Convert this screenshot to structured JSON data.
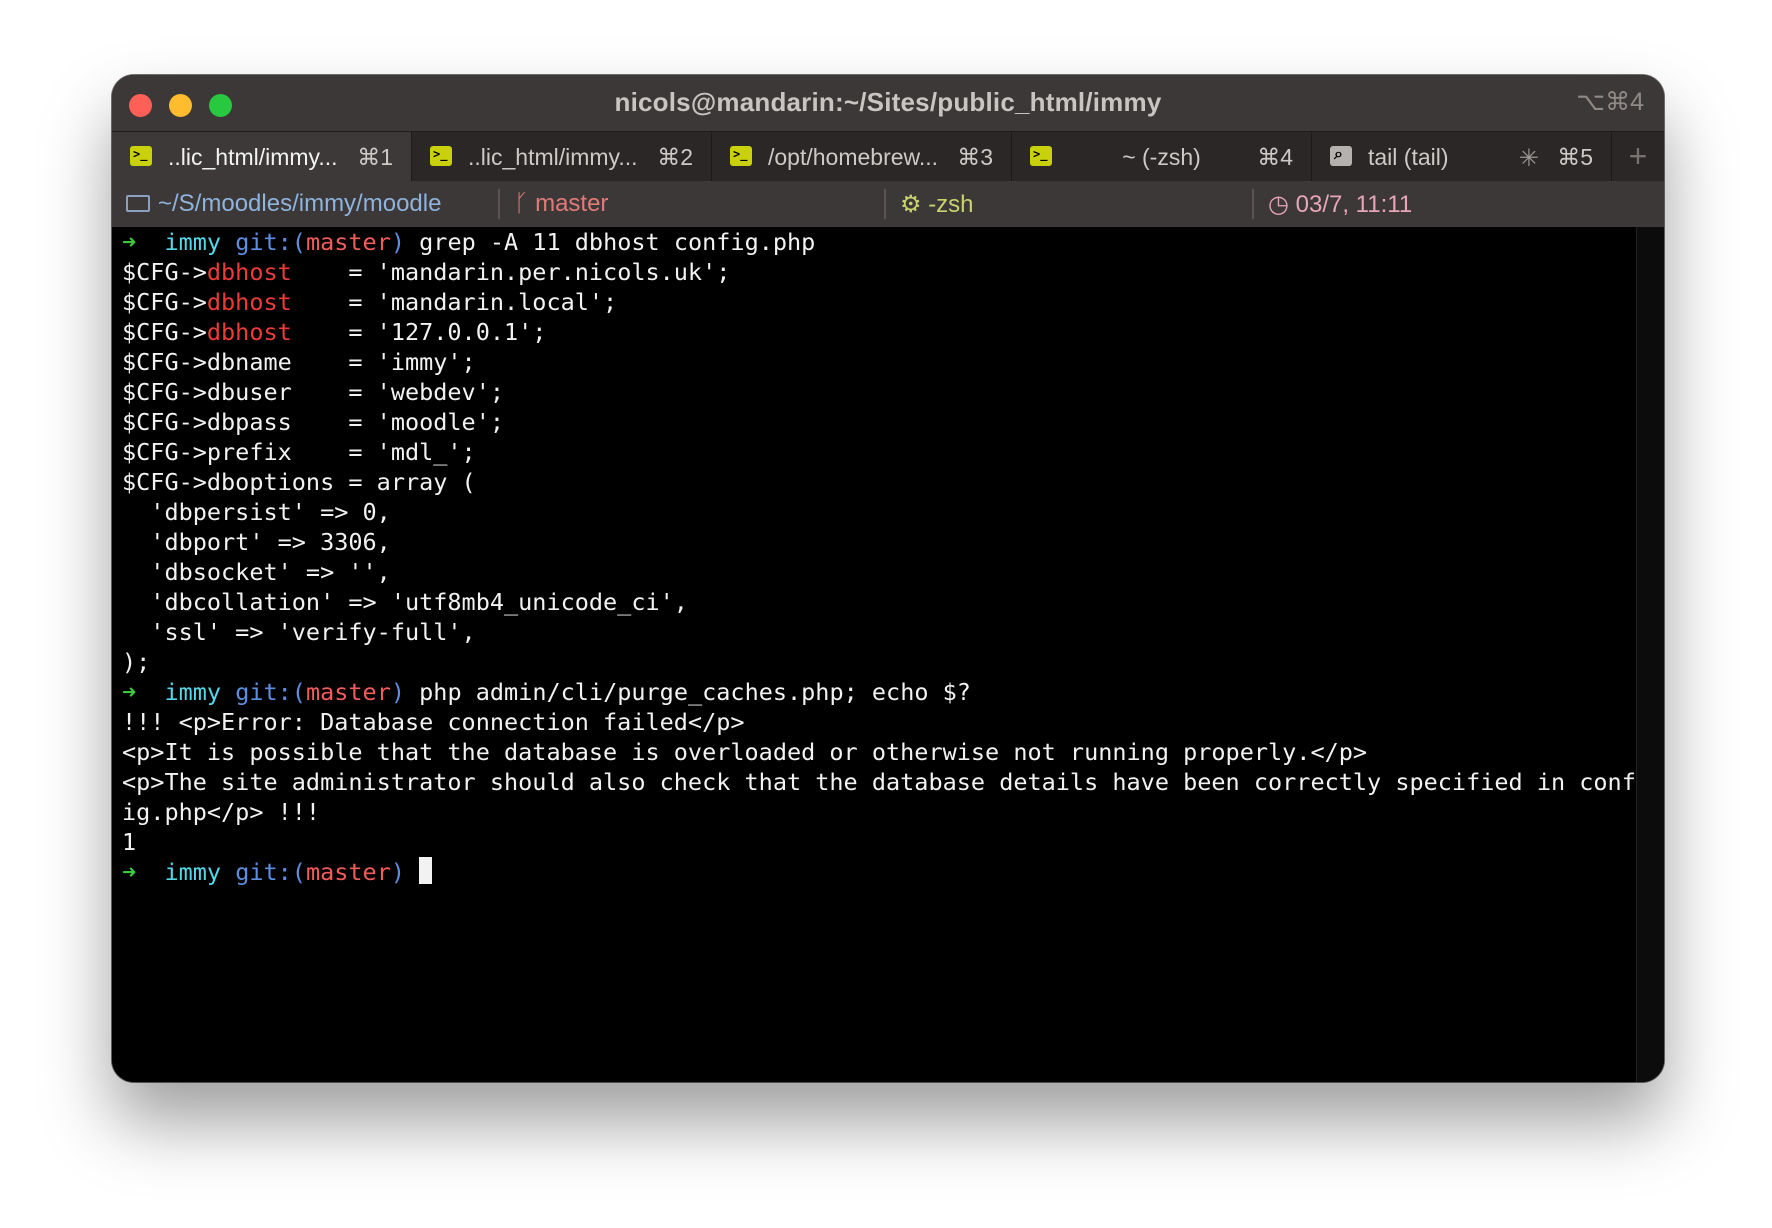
{
  "window": {
    "title": "nicols@mandarin:~/Sites/public_html/immy",
    "shortcut": "⌥⌘4"
  },
  "tabs": [
    {
      "label": "..lic_html/immy...",
      "shortcut": "⌘1",
      "icon": "terminal-icon",
      "active": true
    },
    {
      "label": "..lic_html/immy...",
      "shortcut": "⌘2",
      "icon": "terminal-icon",
      "active": false
    },
    {
      "label": "/opt/homebrew...",
      "shortcut": "⌘3",
      "icon": "terminal-icon",
      "active": false
    },
    {
      "label": "~ (-zsh)",
      "shortcut": "⌘4",
      "icon": "terminal-icon",
      "active": false
    },
    {
      "label": "tail (tail)",
      "shortcut": "⌘5",
      "icon": "search-icon",
      "active": false
    }
  ],
  "new_tab_label": "+",
  "status": {
    "path": "~/S/moodles/immy/moodle",
    "branch": "master",
    "job": "-zsh",
    "time": "03/7, 11:11"
  },
  "prompt": {
    "arrow": "➜",
    "dir": "immy",
    "git_prefix": "git:(",
    "branch": "master",
    "git_suffix": ")"
  },
  "terminal": {
    "cmd1": "grep -A 11 dbhost config.php",
    "cfg_prefix": "$CFG->",
    "dbhost_key": "dbhost",
    "dbhost1_rest": "    = 'mandarin.per.nicols.uk';",
    "dbhost2_rest": "    = 'mandarin.local';",
    "dbhost3_rest": "    = '127.0.0.1';",
    "l_dbname": "$CFG->dbname    = 'immy';",
    "l_dbuser": "$CFG->dbuser    = 'webdev';",
    "l_dbpass": "$CFG->dbpass    = 'moodle';",
    "l_prefix": "$CFG->prefix    = 'mdl_';",
    "l_dboptions": "$CFG->dboptions = array (",
    "l_persist": "  'dbpersist' => 0,",
    "l_port": "  'dbport' => 3306,",
    "l_socket": "  'dbsocket' => '',",
    "l_collation": "  'dbcollation' => 'utf8mb4_unicode_ci',",
    "l_ssl": "  'ssl' => 'verify-full',",
    "l_close": ");",
    "cmd2": "php admin/cli/purge_caches.php; echo $?",
    "err1": "!!! <p>Error: Database connection failed</p>",
    "err2": "<p>It is possible that the database is overloaded or otherwise not running properly.</p>",
    "err3": "<p>The site administrator should also check that the database details have been correctly specified in conf",
    "err4": "ig.php</p> !!!",
    "exit_code": "1"
  },
  "colors": {
    "prompt_arrow": "#3ec83e",
    "prompt_dir": "#52d8ea",
    "git": "#5d8ee0",
    "branch": "#f45c5c",
    "highlight": "#ef3a3a"
  }
}
